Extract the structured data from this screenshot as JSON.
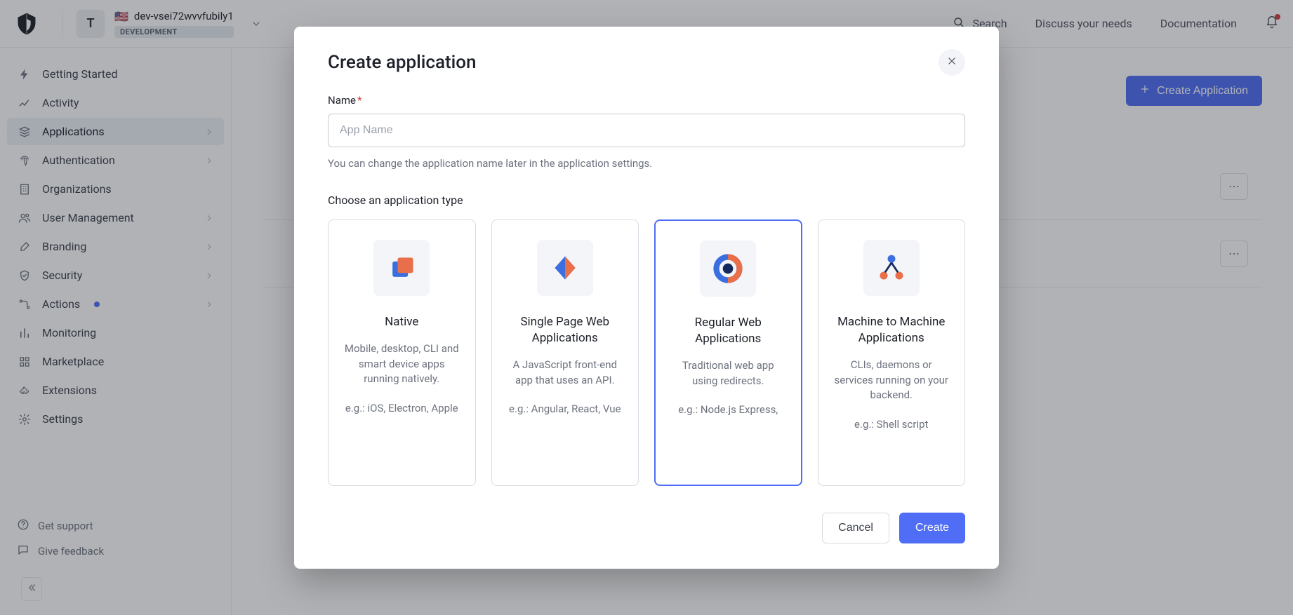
{
  "topbar": {
    "tenant_avatar_letter": "T",
    "tenant_name": "dev-vsei72wvvfubily1",
    "env_badge": "DEVELOPMENT",
    "search_label": "Search",
    "discuss_label": "Discuss your needs",
    "docs_label": "Documentation"
  },
  "sidebar": {
    "items": [
      {
        "label": "Getting Started",
        "icon": "bolt-icon",
        "expandable": false
      },
      {
        "label": "Activity",
        "icon": "chart-icon",
        "expandable": false
      },
      {
        "label": "Applications",
        "icon": "stack-icon",
        "expandable": true,
        "active": true
      },
      {
        "label": "Authentication",
        "icon": "fingerprint-icon",
        "expandable": true
      },
      {
        "label": "Organizations",
        "icon": "building-icon",
        "expandable": false
      },
      {
        "label": "User Management",
        "icon": "users-icon",
        "expandable": true
      },
      {
        "label": "Branding",
        "icon": "brush-icon",
        "expandable": true
      },
      {
        "label": "Security",
        "icon": "shield-icon",
        "expandable": true
      },
      {
        "label": "Actions",
        "icon": "flow-icon",
        "expandable": true,
        "dot": true
      },
      {
        "label": "Monitoring",
        "icon": "bars-icon",
        "expandable": false
      },
      {
        "label": "Marketplace",
        "icon": "grid-icon",
        "expandable": false
      },
      {
        "label": "Extensions",
        "icon": "puzzle-icon",
        "expandable": false
      },
      {
        "label": "Settings",
        "icon": "gear-icon",
        "expandable": false
      }
    ],
    "support_label": "Get support",
    "feedback_label": "Give feedback"
  },
  "main": {
    "create_app_btn": "Create Application"
  },
  "modal": {
    "title": "Create application",
    "name_label": "Name",
    "name_placeholder": "App Name",
    "name_help": "You can change the application name later in the application settings.",
    "type_section_label": "Choose an application type",
    "types": [
      {
        "key": "native",
        "title": "Native",
        "desc": "Mobile, desktop, CLI and smart device apps running natively.",
        "eg": "e.g.: iOS, Electron, Apple"
      },
      {
        "key": "spa",
        "title": "Single Page Web Applications",
        "desc": "A JavaScript front-end app that uses an API.",
        "eg": "e.g.: Angular, React, Vue"
      },
      {
        "key": "regular",
        "title": "Regular Web Applications",
        "desc": "Traditional web app using redirects.",
        "eg": "e.g.: Node.js Express,"
      },
      {
        "key": "m2m",
        "title": "Machine to Machine Applications",
        "desc": "CLIs, daemons or services running on your backend.",
        "eg": "e.g.: Shell script"
      }
    ],
    "selected_type": "regular",
    "cancel_label": "Cancel",
    "create_label": "Create"
  }
}
